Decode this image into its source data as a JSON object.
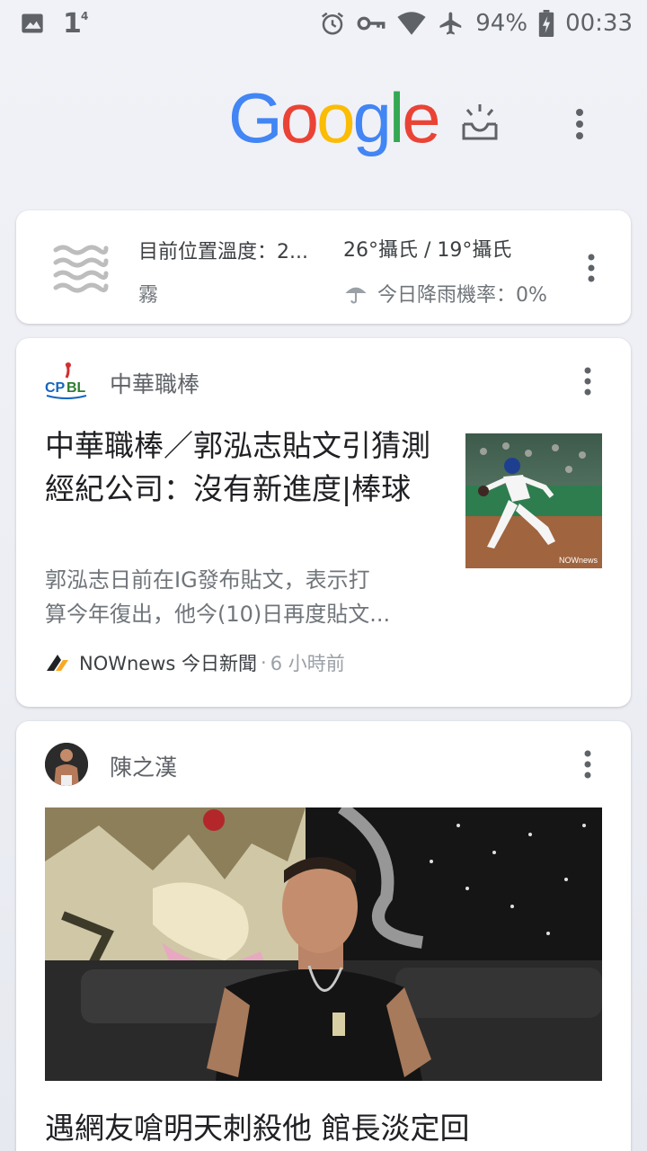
{
  "status_bar": {
    "notification_count": "1",
    "notification_sup": "4",
    "battery": "94%",
    "time": "00:33"
  },
  "header": {
    "logo_letters": [
      {
        "ch": "G",
        "color": "#4285F4"
      },
      {
        "ch": "o",
        "color": "#EA4335"
      },
      {
        "ch": "o",
        "color": "#FBBC05"
      },
      {
        "ch": "g",
        "color": "#4285F4"
      },
      {
        "ch": "l",
        "color": "#34A853"
      },
      {
        "ch": "e",
        "color": "#EA4335"
      }
    ]
  },
  "weather": {
    "title": "目前位置溫度：2...",
    "condition": "霧",
    "temp_range": "26°攝氏 / 19°攝氏",
    "rain": "今日降雨機率：0%",
    "icon": "fog-icon"
  },
  "news1": {
    "source": "中華職棒",
    "title": "中華職棒／郭泓志貼文引猜測經紀公司：沒有新進度|棒球",
    "snippet_lines": [
      "郭泓志日前在IG發布貼文，表示打",
      "算今年復出，他今(10)日再度貼文..."
    ],
    "publisher": "NOWnews 今日新聞",
    "separator": "·",
    "time": "6 小時前",
    "thumb_label": "NOWnews"
  },
  "news2": {
    "source": "陳之漢",
    "title": "遇網友嗆明天刺殺他 館長淡定回"
  }
}
